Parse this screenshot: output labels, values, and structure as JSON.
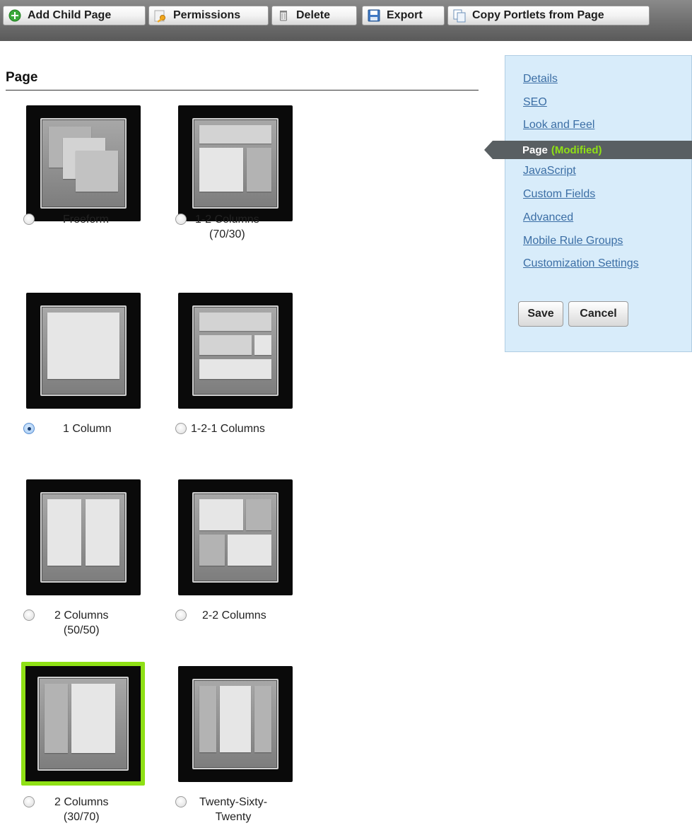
{
  "toolbar": {
    "buttons": [
      {
        "label": "Add Child Page",
        "icon": "add-icon"
      },
      {
        "label": "Permissions",
        "icon": "key-icon"
      },
      {
        "label": "Delete",
        "icon": "trash-icon"
      },
      {
        "label": "Export",
        "icon": "floppy-disk-icon"
      },
      {
        "label": "Copy Portlets from Page",
        "icon": "copy-icon"
      }
    ]
  },
  "page": {
    "heading": "Page",
    "layouts": [
      {
        "line1": "Freeform",
        "line2": "",
        "checked": false
      },
      {
        "line1": "1-2 Columns",
        "line2": "(70/30)",
        "checked": false
      },
      {
        "line1": "1 Column",
        "line2": "",
        "checked": true
      },
      {
        "line1": "1-2-1 Columns",
        "line2": "",
        "checked": false
      },
      {
        "line1": "2 Columns",
        "line2": "(50/50)",
        "checked": false
      },
      {
        "line1": "2-2 Columns",
        "line2": "",
        "checked": false
      },
      {
        "line1": "2 Columns",
        "line2": "(30/70)",
        "checked": false,
        "highlighted": true
      },
      {
        "line1": "Twenty-Sixty-",
        "line2": "Twenty",
        "checked": false
      }
    ]
  },
  "side_nav": {
    "links": [
      "Details",
      "SEO",
      "Look and Feel",
      "JavaScript",
      "Custom Fields",
      "Advanced",
      "Mobile Rule Groups",
      "Customization Settings"
    ],
    "active_label": "Page",
    "active_status": "(Modified)",
    "save_label": "Save",
    "cancel_label": "Cancel"
  },
  "colors": {
    "accent_green": "#8fe015",
    "panel_bg": "#d8ecfa",
    "link": "#3b6ea5",
    "active_bg": "#595f62"
  }
}
